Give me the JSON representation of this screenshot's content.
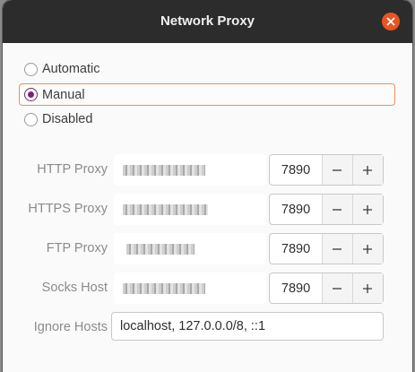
{
  "window": {
    "title": "Network Proxy",
    "accent_color": "#e95420",
    "titlebar_color": "#2c2c2c"
  },
  "modes": [
    {
      "label": "Automatic",
      "selected": false
    },
    {
      "label": "Manual",
      "selected": true
    },
    {
      "label": "Disabled",
      "selected": false
    }
  ],
  "proxies": [
    {
      "label": "HTTP Proxy",
      "port": "7890"
    },
    {
      "label": "HTTPS Proxy",
      "port": "7890"
    },
    {
      "label": "FTP Proxy",
      "port": "7890"
    },
    {
      "label": "Socks Host",
      "port": "7890"
    }
  ],
  "ignore_hosts": {
    "label": "Ignore Hosts",
    "value": "localhost, 127.0.0.0/8, ::1"
  }
}
